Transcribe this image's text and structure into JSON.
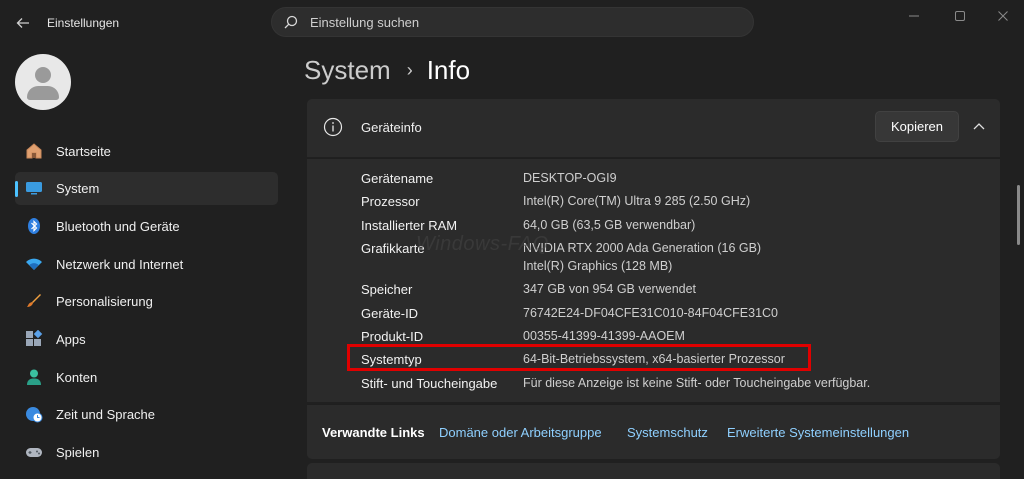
{
  "window": {
    "title": "Einstellungen",
    "back_icon": "arrow-left-icon",
    "controls": [
      "minimize-icon",
      "maximize-icon",
      "close-icon"
    ]
  },
  "search": {
    "placeholder": "Einstellung suchen",
    "value": ""
  },
  "sidebar": {
    "items": [
      {
        "label": "Startseite",
        "icon": "home-icon",
        "active": false
      },
      {
        "label": "System",
        "icon": "monitor-icon",
        "active": true
      },
      {
        "label": "Bluetooth und Geräte",
        "icon": "bluetooth-icon",
        "active": false
      },
      {
        "label": "Netzwerk und Internet",
        "icon": "wifi-icon",
        "active": false
      },
      {
        "label": "Personalisierung",
        "icon": "brush-icon",
        "active": false
      },
      {
        "label": "Apps",
        "icon": "apps-icon",
        "active": false
      },
      {
        "label": "Konten",
        "icon": "person-icon",
        "active": false
      },
      {
        "label": "Zeit und Sprache",
        "icon": "globe-clock-icon",
        "active": false
      },
      {
        "label": "Spielen",
        "icon": "gamepad-icon",
        "active": false
      }
    ]
  },
  "breadcrumb": {
    "parent": "System",
    "separator": "›",
    "current": "Info"
  },
  "device_info": {
    "title": "Geräteinfo",
    "copy_label": "Kopieren",
    "specs": [
      {
        "label": "Gerätename",
        "value": "DESKTOP-OGI9"
      },
      {
        "label": "Prozessor",
        "value": "Intel(R) Core(TM) Ultra 9 285 (2.50 GHz)"
      },
      {
        "label": "Installierter RAM",
        "value": "64,0 GB (63,5 GB verwendbar)"
      },
      {
        "label": "Grafikkarte",
        "value": "NVIDIA RTX 2000 Ada Generation (16 GB)",
        "value2": "Intel(R) Graphics (128 MB)"
      },
      {
        "label": "Speicher",
        "value": "347 GB von 954 GB verwendet"
      },
      {
        "label": "Geräte-ID",
        "value": "76742E24-DF04CFE31C010-84F04CFE31C0"
      },
      {
        "label": "Produkt-ID",
        "value": "00355-41399-41399-AAOEM"
      },
      {
        "label": "Systemtyp",
        "value": "64-Bit-Betriebssystem, x64-basierter Prozessor"
      },
      {
        "label": "Stift- und Toucheingabe",
        "value": "Für diese Anzeige ist keine Stift- oder Toucheingabe verfügbar."
      }
    ]
  },
  "related_links": {
    "title": "Verwandte Links",
    "links": [
      "Domäne oder Arbeitsgruppe",
      "Systemschutz",
      "Erweiterte Systemeinstellungen"
    ]
  },
  "watermark": "Windows-FAQ",
  "colors": {
    "accent": "#4cc2ff",
    "link": "#8fd0ff",
    "highlight": "#e00000",
    "background": "#202020",
    "card": "#2b2b2b"
  }
}
